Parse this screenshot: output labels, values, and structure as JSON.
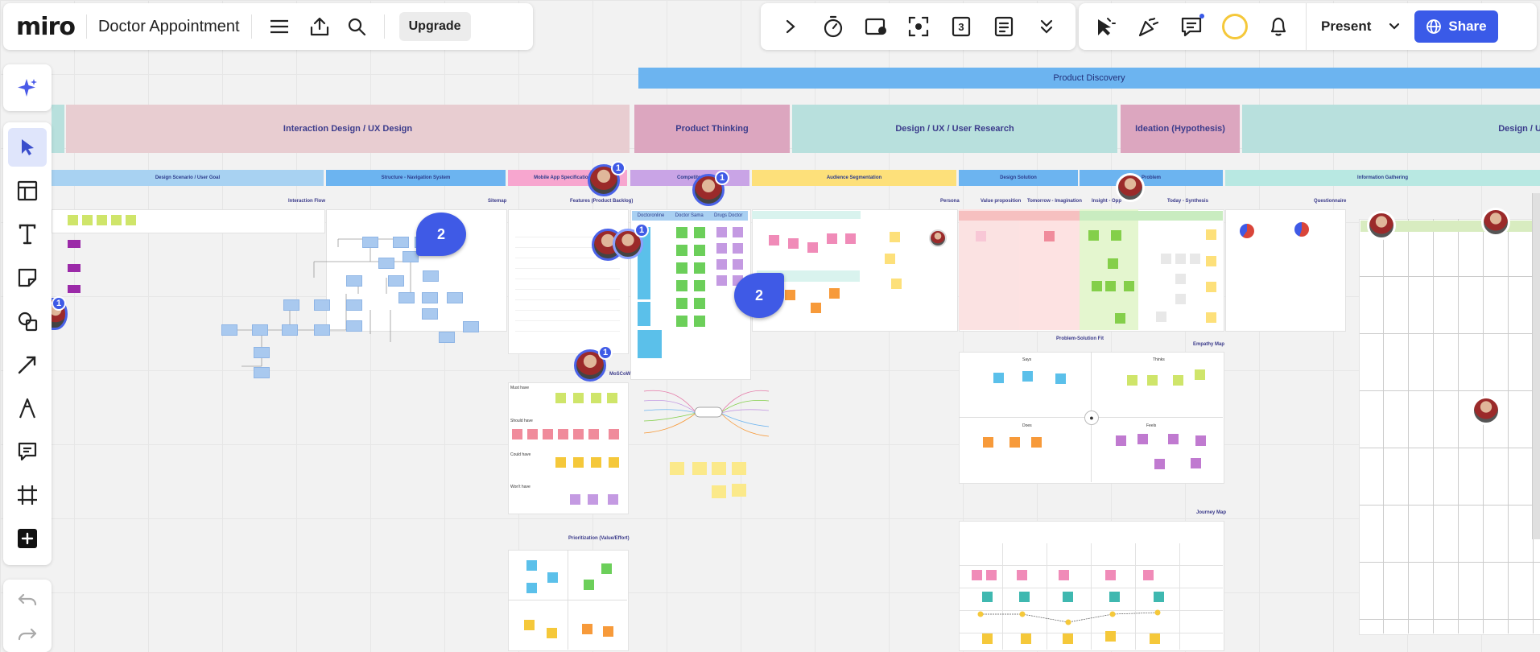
{
  "app": {
    "logo": "miro",
    "board_title": "Doctor Appointment",
    "upgrade_label": "Upgrade"
  },
  "toolbar_right": {
    "present_label": "Present",
    "share_label": "Share",
    "timer_count": "3"
  },
  "colors": {
    "accent": "#3a5ae8",
    "band_blue": "#6cb4f0",
    "band_pink": "#e8cdd1",
    "band_rose": "#dca6bf",
    "band_teal": "#b8e0dd",
    "band_yellow": "#fde07a",
    "band_purple": "#c9a4e6",
    "band_magenta": "#f7a6cf"
  },
  "canvas": {
    "top_band": "Product Discovery",
    "sections": [
      "Interaction Design / UX Design",
      "Product Thinking",
      "Design / UX / User Research",
      "Ideation (Hypothesis)",
      "Design / U"
    ],
    "subsections": [
      "Design Scenario / User Goal",
      "Structure - Navigation System",
      "Mobile App Specification (MV",
      "Competitor",
      "Audience Segmentation",
      "Design Solution",
      "Problem",
      "Information Gathering"
    ],
    "labels": {
      "interaction_flow": "Interaction Flow",
      "sitemap": "Sitemap",
      "features": "Features (Product Backlog)",
      "persona": "Persona",
      "value_prop": "Value proposition",
      "tomorrow": "Tomorrow - Imagination",
      "insight": "Insight - Opp",
      "today": "Today - Synthesis",
      "questionnaire": "Questionnaire",
      "ps_fit": "Problem-Solution Fit",
      "empathy_map": "Empathy Map",
      "journey_map": "Journey Map",
      "moscow": "MoSCoW",
      "prioritization": "Prioritization (Value/Effort)",
      "must_have": "Must have",
      "should_have": "Should have",
      "could_have": "Could have",
      "wont_have": "Won't have",
      "doctoronline": "Doctoronline",
      "doctor_sama": "Doctor Sama",
      "drugs_doctor": "Drugs Doctor",
      "says": "Says",
      "thinks": "Thinks",
      "does": "Does",
      "feels": "Feels"
    },
    "counts": {
      "cluster_a": "2",
      "cluster_b": "2",
      "badge": "1"
    }
  }
}
